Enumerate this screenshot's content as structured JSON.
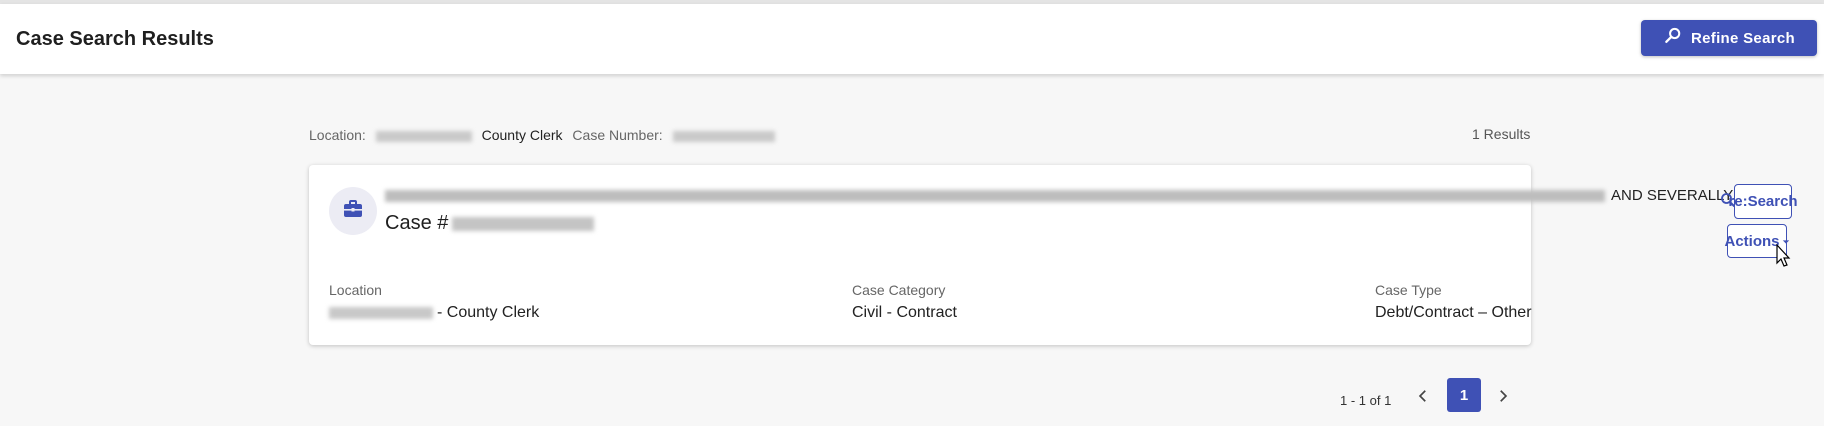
{
  "header": {
    "title": "Case Search Results",
    "refine_label": "Refine Search"
  },
  "criteria": {
    "location_label": "Location:",
    "location_suffix": "County Clerk",
    "case_number_label": "Case Number:"
  },
  "results_count": "1 Results",
  "card": {
    "parties_suffix": "AND SEVERALLY",
    "case_prefix": "Case #",
    "fields": {
      "location": {
        "label": "Location",
        "value": "- County Clerk"
      },
      "category": {
        "label": "Case Category",
        "value": "Civil - Contract"
      },
      "type": {
        "label": "Case Type",
        "value": "Debt/Contract – Other"
      }
    },
    "research_label": "re:Search",
    "actions_label": "Actions"
  },
  "pagination": {
    "range": "1 - 1 of 1",
    "current": "1"
  },
  "colors": {
    "primary": "#3f51b5"
  },
  "icons": {
    "refine": "search-refine-icon",
    "case": "briefcase-icon",
    "prev": "chevron-left-icon",
    "next": "chevron-right-icon",
    "actions": "caret-down-icon"
  }
}
